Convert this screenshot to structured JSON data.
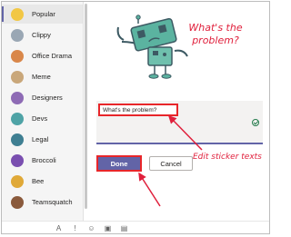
{
  "sidebar": {
    "items": [
      {
        "label": "Popular",
        "icon": "star-icon",
        "color": "#f2c744",
        "selected": true
      },
      {
        "label": "Clippy",
        "icon": "clippy-icon",
        "color": "#9aa7b4"
      },
      {
        "label": "Office Drama",
        "icon": "office-drama-icon",
        "color": "#d9874a"
      },
      {
        "label": "Meme",
        "icon": "meme-icon",
        "color": "#c9a77a"
      },
      {
        "label": "Designers",
        "icon": "designers-icon",
        "color": "#8e6bb5"
      },
      {
        "label": "Devs",
        "icon": "devs-icon",
        "color": "#4fa3a6"
      },
      {
        "label": "Legal",
        "icon": "legal-icon",
        "color": "#3f7f92"
      },
      {
        "label": "Broccoli",
        "icon": "broccoli-icon",
        "color": "#7a4fb0"
      },
      {
        "label": "Bee",
        "icon": "bee-icon",
        "color": "#e0a938"
      },
      {
        "label": "Teamsquatch",
        "icon": "teamsquatch-icon",
        "color": "#8a5a3c"
      }
    ]
  },
  "sticker": {
    "caption": "What's the problem?",
    "caption_color": "#e0203c",
    "robot_color": "#5bb3a0"
  },
  "editor": {
    "text_value": "What's the problem?",
    "done_label": "Done",
    "cancel_label": "Cancel",
    "accent": "#6264a7"
  },
  "annotation": {
    "text": "Edit sticker texts",
    "color": "#e0203c"
  },
  "toolbar": {
    "icons": [
      "format-icon",
      "priority-icon",
      "emoji-icon",
      "gif-icon",
      "sticker-icon"
    ]
  }
}
